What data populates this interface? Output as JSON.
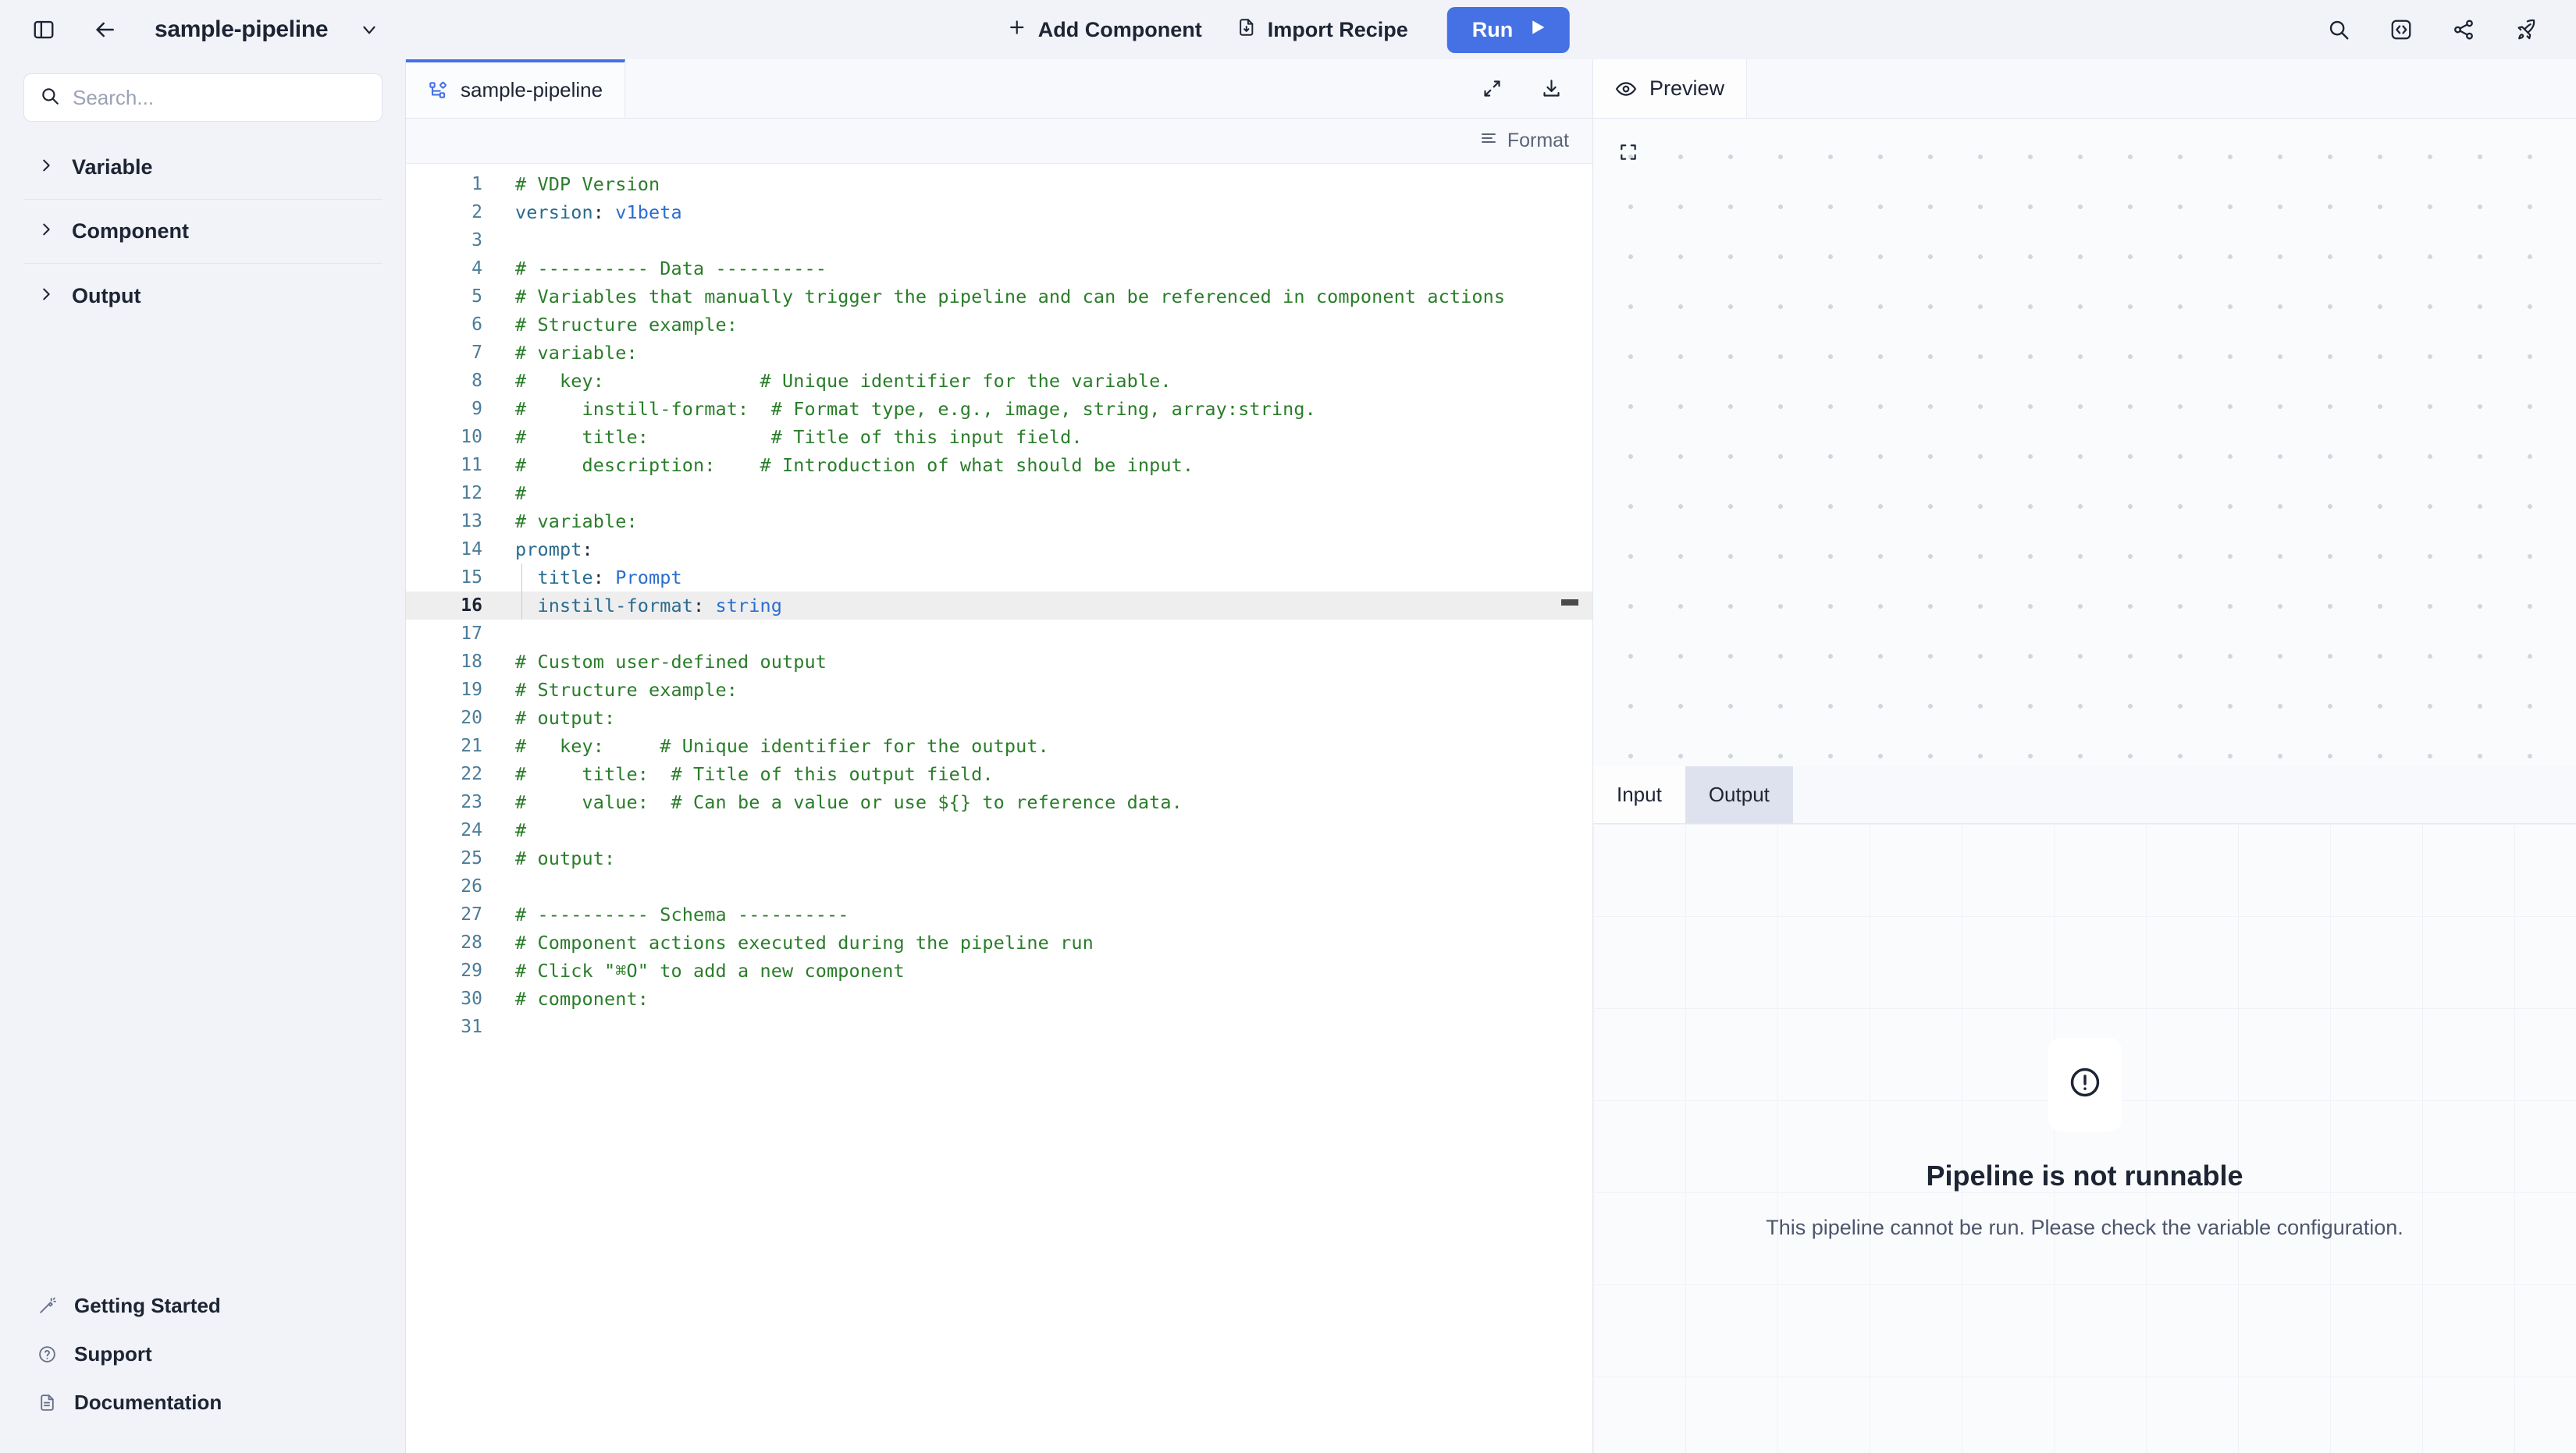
{
  "topbar": {
    "panel_toggle_icon": "panel-toggle-icon",
    "back_icon": "arrow-left-icon",
    "pipeline_title": "sample-pipeline",
    "title_chevron_icon": "chevron-down-icon",
    "add_component_label": "Add Component",
    "import_recipe_label": "Import Recipe",
    "run_label": "Run",
    "run_button_color": "#4571e4",
    "right_icons": [
      "search-icon",
      "code-icon",
      "share-icon",
      "rocket-icon"
    ]
  },
  "sidebar": {
    "search": {
      "value": "",
      "placeholder": "Search..."
    },
    "sections": [
      {
        "label": "Variable"
      },
      {
        "label": "Component"
      },
      {
        "label": "Output"
      }
    ],
    "footer": [
      {
        "label": "Getting Started",
        "icon": "magic-wand-icon"
      },
      {
        "label": "Support",
        "icon": "help-circle-icon"
      },
      {
        "label": "Documentation",
        "icon": "document-icon"
      }
    ]
  },
  "editor": {
    "tab_label": "sample-pipeline",
    "tab_icon": "pipeline-icon",
    "expand_icon": "expand-icon",
    "download_icon": "download-icon",
    "format_label": "Format",
    "format_icon": "list-icon",
    "active_line": 16,
    "lines": [
      {
        "n": 1,
        "tokens": [
          {
            "t": "comment",
            "v": "# VDP Version"
          }
        ]
      },
      {
        "n": 2,
        "tokens": [
          {
            "t": "key",
            "v": "version"
          },
          {
            "t": "punct",
            "v": ":"
          },
          {
            "t": "val",
            "v": " v1beta"
          }
        ]
      },
      {
        "n": 3,
        "tokens": []
      },
      {
        "n": 4,
        "tokens": [
          {
            "t": "comment",
            "v": "# ---------- Data ----------"
          }
        ]
      },
      {
        "n": 5,
        "tokens": [
          {
            "t": "comment",
            "v": "# Variables that manually trigger the pipeline and can be referenced in component actions"
          }
        ]
      },
      {
        "n": 6,
        "tokens": [
          {
            "t": "comment",
            "v": "# Structure example:"
          }
        ]
      },
      {
        "n": 7,
        "tokens": [
          {
            "t": "comment",
            "v": "# variable:"
          }
        ]
      },
      {
        "n": 8,
        "tokens": [
          {
            "t": "comment",
            "v": "#   key:              # Unique identifier for the variable."
          }
        ]
      },
      {
        "n": 9,
        "tokens": [
          {
            "t": "comment",
            "v": "#     instill-format:  # Format type, e.g., image, string, array:string."
          }
        ]
      },
      {
        "n": 10,
        "tokens": [
          {
            "t": "comment",
            "v": "#     title:           # Title of this input field."
          }
        ]
      },
      {
        "n": 11,
        "tokens": [
          {
            "t": "comment",
            "v": "#     description:    # Introduction of what should be input."
          }
        ]
      },
      {
        "n": 12,
        "tokens": [
          {
            "t": "comment",
            "v": "#"
          }
        ]
      },
      {
        "n": 13,
        "tokens": [
          {
            "t": "comment",
            "v": "# variable:"
          }
        ]
      },
      {
        "n": 14,
        "tokens": [
          {
            "t": "key",
            "v": "prompt"
          },
          {
            "t": "punct",
            "v": ":"
          }
        ]
      },
      {
        "n": 15,
        "tokens": [
          {
            "t": "key",
            "v": "  title"
          },
          {
            "t": "punct",
            "v": ":"
          },
          {
            "t": "val",
            "v": " Prompt"
          }
        ]
      },
      {
        "n": 16,
        "tokens": [
          {
            "t": "key",
            "v": "  instill-format"
          },
          {
            "t": "punct",
            "v": ":"
          },
          {
            "t": "val",
            "v": " string"
          }
        ]
      },
      {
        "n": 17,
        "tokens": []
      },
      {
        "n": 18,
        "tokens": [
          {
            "t": "comment",
            "v": "# Custom user-defined output"
          }
        ]
      },
      {
        "n": 19,
        "tokens": [
          {
            "t": "comment",
            "v": "# Structure example:"
          }
        ]
      },
      {
        "n": 20,
        "tokens": [
          {
            "t": "comment",
            "v": "# output:"
          }
        ]
      },
      {
        "n": 21,
        "tokens": [
          {
            "t": "comment",
            "v": "#   key:     # Unique identifier for the output."
          }
        ]
      },
      {
        "n": 22,
        "tokens": [
          {
            "t": "comment",
            "v": "#     title:  # Title of this output field."
          }
        ]
      },
      {
        "n": 23,
        "tokens": [
          {
            "t": "comment",
            "v": "#     value:  # Can be a value or use ${} to reference data."
          }
        ]
      },
      {
        "n": 24,
        "tokens": [
          {
            "t": "comment",
            "v": "#"
          }
        ]
      },
      {
        "n": 25,
        "tokens": [
          {
            "t": "comment",
            "v": "# output:"
          }
        ]
      },
      {
        "n": 26,
        "tokens": []
      },
      {
        "n": 27,
        "tokens": [
          {
            "t": "comment",
            "v": "# ---------- Schema ----------"
          }
        ]
      },
      {
        "n": 28,
        "tokens": [
          {
            "t": "comment",
            "v": "# Component actions executed during the pipeline run"
          }
        ]
      },
      {
        "n": 29,
        "tokens": [
          {
            "t": "comment",
            "v": "# Click \"⌘O\" to add a new component"
          }
        ]
      },
      {
        "n": 30,
        "tokens": [
          {
            "t": "comment",
            "v": "# component:"
          }
        ]
      },
      {
        "n": 31,
        "tokens": []
      }
    ]
  },
  "preview": {
    "tab_label": "Preview",
    "tab_icon": "eye-icon",
    "canvas_tool_icon": "fullscreen-icon",
    "io_tabs": [
      {
        "label": "Input",
        "active": true
      },
      {
        "label": "Output",
        "active": false
      }
    ],
    "error": {
      "icon": "alert-circle-icon",
      "title": "Pipeline is not runnable",
      "description": "This pipeline cannot be run. Please check the variable configuration."
    }
  }
}
